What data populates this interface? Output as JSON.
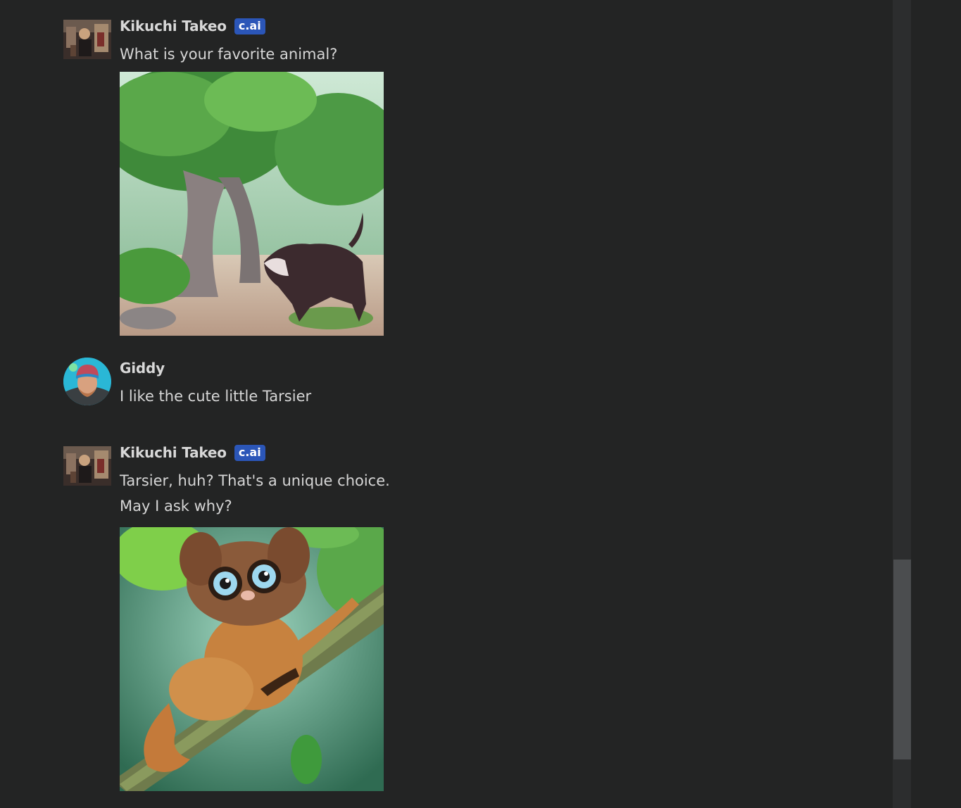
{
  "messages": [
    {
      "author": "Kikuchi Takeo",
      "badge": "c.ai",
      "text": "What is your favorite animal?",
      "avatar": "bot-avatar-icon",
      "image": "forest-wolf-illustration"
    },
    {
      "author": "Giddy",
      "text": "I like the cute little Tarsier",
      "avatar": "user-avatar-icon"
    },
    {
      "author": "Kikuchi Takeo",
      "badge": "c.ai",
      "text_lines": [
        "Tarsier, huh? That's a unique choice.",
        "May I ask why?"
      ],
      "avatar": "bot-avatar-icon",
      "image": "tarsier-illustration"
    }
  ],
  "colors": {
    "background": "#232424",
    "badge": "#2b56b8",
    "scrollbar_track": "#2c2d2e",
    "scrollbar_thumb": "#4b4d4f"
  }
}
